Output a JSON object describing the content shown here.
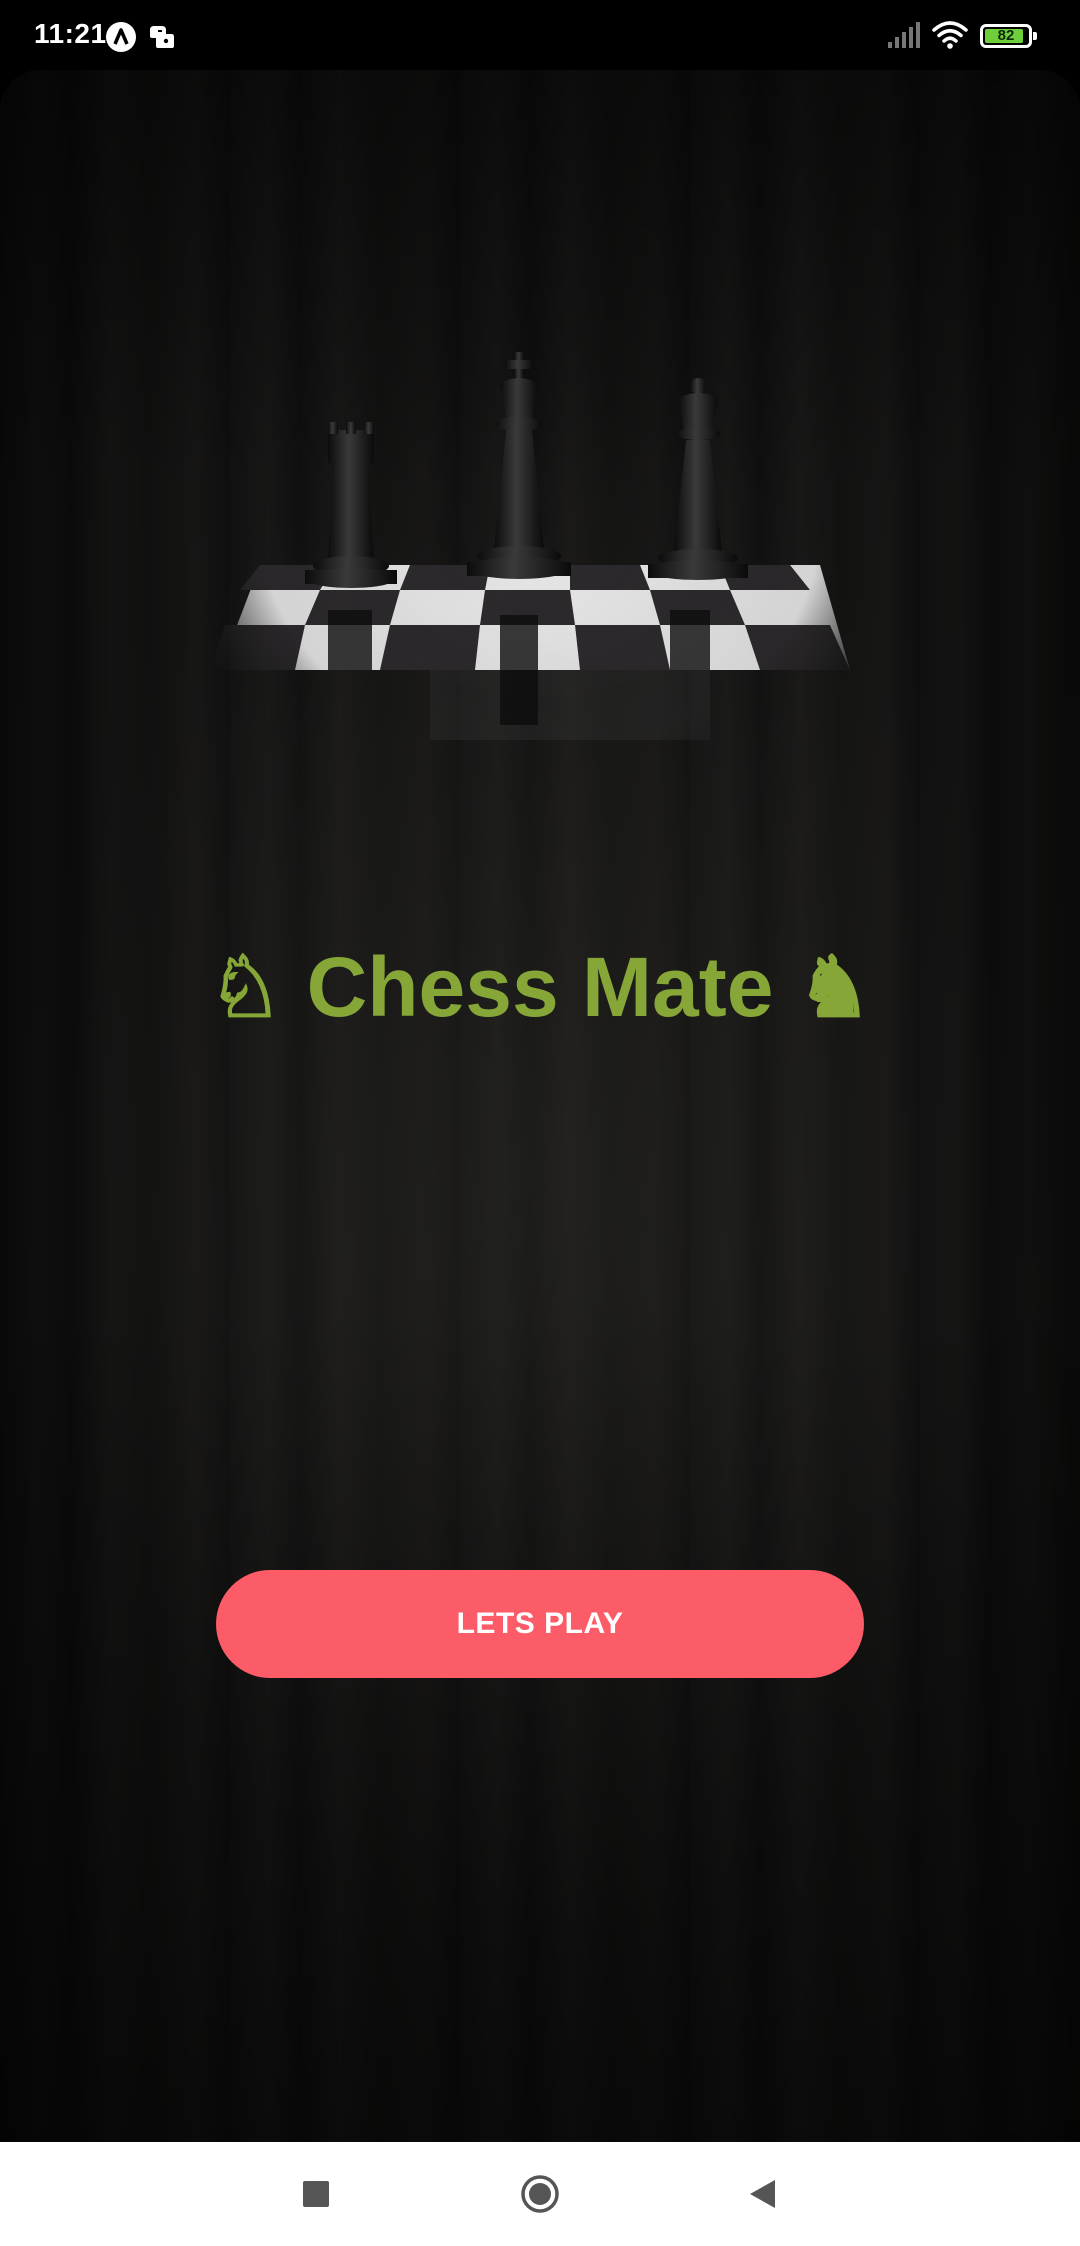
{
  "status_bar": {
    "time": "11:21",
    "battery_level": "82",
    "icons": [
      "android-circle-icon",
      "game-controller-icon",
      "signal-icon",
      "wifi-icon",
      "battery-icon"
    ]
  },
  "main": {
    "title_icon_left": "♘",
    "title_text": "Chess Mate",
    "title_icon_right": "♞",
    "play_button_label": "LETS PLAY"
  },
  "colors": {
    "title": "#86a638",
    "play_button": "#fb5c68",
    "background": "#151515",
    "nav_bar": "#ffffff"
  },
  "nav_bar": {
    "buttons": [
      "recents-button",
      "home-button",
      "back-button"
    ]
  }
}
